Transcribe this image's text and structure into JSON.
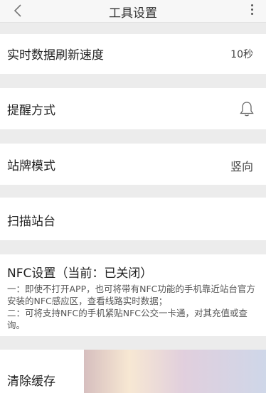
{
  "header": {
    "title": "工具设置",
    "back_icon": "chevron-left-icon",
    "more_icon": "more-vertical-icon"
  },
  "settings": {
    "refresh_speed": {
      "label": "实时数据刷新速度",
      "value": "10秒"
    },
    "reminder": {
      "label": "提醒方式",
      "icon": "bell-icon"
    },
    "stop_sign_mode": {
      "label": "站牌模式",
      "value": "竖向"
    },
    "scan_station": {
      "label": "扫描站台"
    },
    "nfc": {
      "title": "NFC设置（当前：已关闭）",
      "desc1": "一：即使不打开APP，也可将带有NFC功能的手机靠近站台官方安装的NFC感应区，查看线路实时数据；",
      "desc2": "二：可将支持NFC的手机紧贴NFC公交一卡通，对其充值或查询。"
    },
    "clear_cache": {
      "label": "清除缓存"
    }
  }
}
